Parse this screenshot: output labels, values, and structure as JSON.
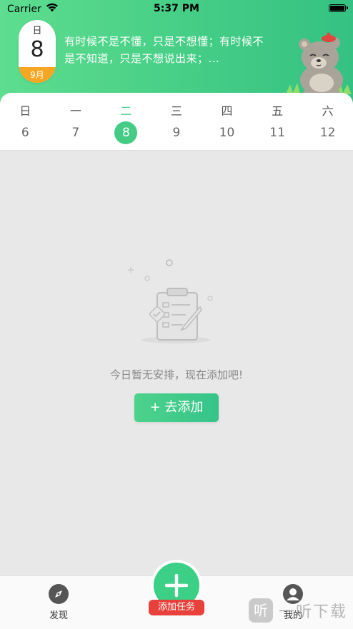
{
  "status_bar": {
    "carrier": "Carrier",
    "time": "5:37 PM"
  },
  "header": {
    "date_badge": {
      "weekday": "日",
      "day": "8",
      "month": "9月"
    },
    "quote": "有时候不是不懂，只是不想懂；有时候不是不知道，只是不想说出来；..."
  },
  "week": {
    "labels": [
      "日",
      "一",
      "二",
      "三",
      "四",
      "五",
      "六"
    ],
    "days": [
      "6",
      "7",
      "8",
      "9",
      "10",
      "11",
      "12"
    ],
    "selected_index": 2
  },
  "empty_state": {
    "message": "今日暂无安排，现在添加吧!",
    "add_button": "+ 去添加"
  },
  "tab_bar": {
    "discover": "发现",
    "add_task": "添加任务",
    "mine": "我的"
  },
  "watermark": {
    "logo": "听",
    "text": "一听下载"
  },
  "colors": {
    "accent": "#44cc85",
    "month_tag": "#f5a623",
    "add_task_tag": "#e8413b"
  }
}
